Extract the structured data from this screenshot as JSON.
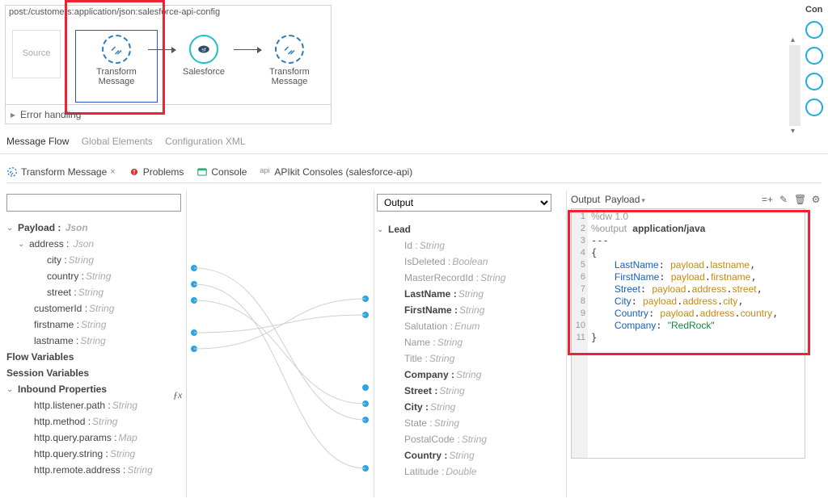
{
  "flow": {
    "title": "post:/customers:application/json:salesforce-api-config",
    "source_label": "Source",
    "nodes": [
      {
        "label": "Transform Message"
      },
      {
        "label": "Salesforce"
      },
      {
        "label": "Transform Message"
      }
    ],
    "error_row": "Error handling"
  },
  "side": {
    "label": "Con"
  },
  "sub_tabs": {
    "active": "Message Flow",
    "others": [
      "Global Elements",
      "Configuration XML"
    ]
  },
  "bottom_tabs": {
    "transform": "Transform Message",
    "problems": "Problems",
    "console": "Console",
    "apikit": "APIkit Consoles (salesforce-api)"
  },
  "left": {
    "filter": "",
    "payload": {
      "label": "Payload :",
      "type": "Json",
      "address": {
        "label": "address :",
        "type": "Json",
        "city": {
          "label": "city :",
          "type": "String"
        },
        "country": {
          "label": "country :",
          "type": "String"
        },
        "street": {
          "label": "street :",
          "type": "String"
        }
      },
      "customerId": {
        "label": "customerId :",
        "type": "String"
      },
      "firstname": {
        "label": "firstname :",
        "type": "String"
      },
      "lastname": {
        "label": "lastname :",
        "type": "String"
      }
    },
    "flowVars": "Flow Variables",
    "sessionVars": "Session Variables",
    "inbound": {
      "label": "Inbound Properties",
      "items": [
        {
          "label": "http.listener.path :",
          "type": "String"
        },
        {
          "label": "http.method :",
          "type": "String"
        },
        {
          "label": "http.query.params :",
          "type": "Map"
        },
        {
          "label": "http.query.string :",
          "type": "String"
        },
        {
          "label": "http.remote.address :",
          "type": "String"
        }
      ]
    }
  },
  "mid": {
    "select_label": "Output",
    "lead": {
      "label": "Lead",
      "fields": [
        {
          "label": "Id :",
          "type": "String",
          "mapped": false
        },
        {
          "label": "IsDeleted :",
          "type": "Boolean",
          "mapped": false
        },
        {
          "label": "MasterRecordId :",
          "type": "String",
          "mapped": false
        },
        {
          "label": "LastName :",
          "type": "String",
          "mapped": true
        },
        {
          "label": "FirstName :",
          "type": "String",
          "mapped": true
        },
        {
          "label": "Salutation :",
          "type": "Enum",
          "mapped": false
        },
        {
          "label": "Name :",
          "type": "String",
          "mapped": false
        },
        {
          "label": "Title :",
          "type": "String",
          "mapped": false
        },
        {
          "label": "Company :",
          "type": "String",
          "mapped": true
        },
        {
          "label": "Street :",
          "type": "String",
          "mapped": true
        },
        {
          "label": "City :",
          "type": "String",
          "mapped": true
        },
        {
          "label": "State :",
          "type": "String",
          "mapped": false
        },
        {
          "label": "PostalCode :",
          "type": "String",
          "mapped": false
        },
        {
          "label": "Country :",
          "type": "String",
          "mapped": true
        },
        {
          "label": "Latitude :",
          "type": "Double",
          "mapped": false
        }
      ]
    }
  },
  "right": {
    "out_label": "Output",
    "payload_label": "Payload",
    "code_lines": [
      "%dw 1.0",
      "%output application/java",
      "---",
      "{",
      "    LastName: payload.lastname,",
      "    FirstName: payload.firstname,",
      "    Street: payload.address.street,",
      "    City: payload.address.city,",
      "    Country: payload.address.country,",
      "    Company: \"RedRock\"",
      "}"
    ],
    "icons": {
      "add": "=+",
      "edit": "✎",
      "delete": "🗑",
      "settings": "⚙"
    }
  }
}
